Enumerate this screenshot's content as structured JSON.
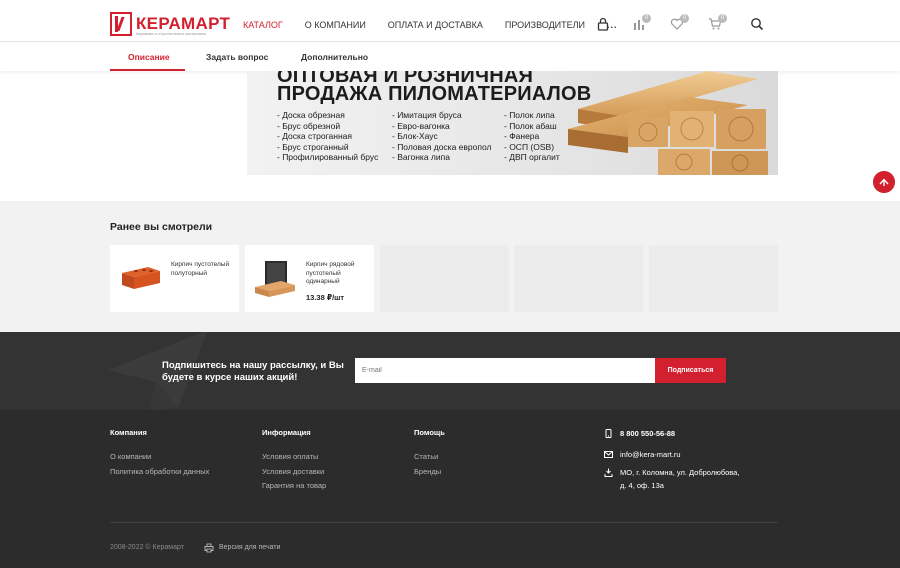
{
  "header": {
    "logo_text": "КЕРАМАРТ",
    "logo_sub": "керамика и строительные материалы",
    "nav": [
      "КАТАЛОГ",
      "О КОМПАНИИ",
      "ОПЛАТА И ДОСТАВКА",
      "ПРОИЗВОДИТЕЛИ",
      "..."
    ],
    "nav_active": "КАТАЛОГ",
    "compare_count": "0",
    "wishlist_count": "0",
    "cart_count": "0"
  },
  "subtabs": [
    "Описание",
    "Задать вопрос",
    "Дополнительно"
  ],
  "banner": {
    "title_1": "ОПТОВАЯ И РОЗНИЧНАЯ",
    "title_2": "ПРОДАЖА ПИЛОМАТЕРИАЛОВ",
    "col1": [
      "- Доска обрезная",
      "- Брус обрезной",
      "- Доска строганная",
      "- Брус строганный",
      "- Профилированный брус"
    ],
    "col2": [
      "- Имитация бруса",
      "- Евро-вагонка",
      "- Блок-Хаус",
      "- Половая доска европол",
      "- Вагонка липа"
    ],
    "col3": [
      "- Полок липа",
      "- Полок абаш",
      "- Фанера",
      "- ОСП (OSB)",
      "- ДВП оргалит"
    ]
  },
  "viewed": {
    "title": "Ранее вы смотрели",
    "items": [
      {
        "name": "Кирпич пустотелый полуторный",
        "price": ""
      },
      {
        "name": "Кирпич рядовой пустотелый одинарный",
        "price": "13.38 ₽/шт"
      }
    ]
  },
  "subscribe": {
    "text": "Подпишитесь на нашу рассылку, и Вы будете в курсе наших акций!",
    "placeholder": "E-mail",
    "button": "Подписаться"
  },
  "footer": {
    "company": {
      "title": "Компания",
      "links": [
        "О компании",
        "Политика обработки данных"
      ]
    },
    "info": {
      "title": "Информация",
      "links": [
        "Условия оплаты",
        "Условия доставки",
        "Гарантия на товар"
      ]
    },
    "help": {
      "title": "Помощь",
      "links": [
        "Статьи",
        "Бренды"
      ]
    },
    "phone": "8 800 550-56-88",
    "email": "info@kera-mart.ru",
    "address_1": "МО, г. Коломна, ул. Добролюбова,",
    "address_2": "д. 4, оф. 13а",
    "copyright": "2008-2022 © Керамарт",
    "print": "Версия для печати"
  },
  "colors": {
    "accent": "#d3202e",
    "footer_bg": "#2c2c2d",
    "subscribe_bg": "#333334"
  }
}
